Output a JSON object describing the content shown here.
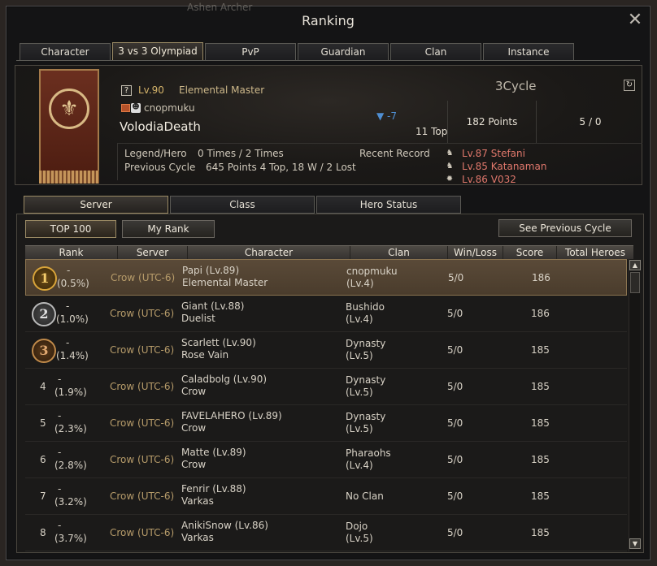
{
  "background_label": "Ashen Archer",
  "window": {
    "title": "Ranking"
  },
  "tabs": [
    {
      "label": "Character"
    },
    {
      "label": "3 vs 3 Olympiad"
    },
    {
      "label": "PvP"
    },
    {
      "label": "Guardian"
    },
    {
      "label": "Clan"
    },
    {
      "label": "Instance"
    }
  ],
  "active_tab": "3 vs 3 Olympiad",
  "profile": {
    "badge": "?",
    "level": "Lv.90",
    "class": "Elemental Master",
    "clan": "cnopmuku",
    "name": "VolodiaDeath",
    "rank_change": "-7",
    "rank": "11 Top",
    "cycle": "3Cycle",
    "points": "182 Points",
    "win_loss": "5 /  0",
    "legend_label": "Legend/Hero",
    "legend_value": "0 Times / 2 Times",
    "prev_label": "Previous Cycle",
    "prev_value": "645 Points 4 Top,  18 W / 2 Lost",
    "recent_label": "Recent Record",
    "recent": [
      {
        "text": "Lv.87 Stefani"
      },
      {
        "text": "Lv.85 Katanaman"
      },
      {
        "text": "Lv.86 V032"
      }
    ]
  },
  "subtabs": [
    {
      "label": "Server"
    },
    {
      "label": "Class"
    },
    {
      "label": "Hero Status"
    }
  ],
  "buttons": {
    "top100": "TOP 100",
    "myrank": "My Rank",
    "prev_cycle": "See Previous Cycle"
  },
  "columns": [
    "Rank",
    "Server",
    "Character",
    "Clan",
    "Win/Loss",
    "Score",
    "Total Heroes"
  ],
  "rows": [
    {
      "rank": "1",
      "medal": "gold",
      "pct1": "-",
      "pct2": "(0.5%)",
      "server": "Crow (UTC-6)",
      "char1": "Papi (Lv.89)",
      "char2": "Elemental Master",
      "clan1": "cnopmuku",
      "clan2": "(Lv.4)",
      "wl": "5/0",
      "score": "186"
    },
    {
      "rank": "2",
      "medal": "silver",
      "pct1": "-",
      "pct2": "(1.0%)",
      "server": "Crow (UTC-6)",
      "char1": "Giant (Lv.88)",
      "char2": "Duelist",
      "clan1": "Bushido",
      "clan2": "(Lv.4)",
      "wl": "5/0",
      "score": "186"
    },
    {
      "rank": "3",
      "medal": "bronze",
      "pct1": "-",
      "pct2": "(1.4%)",
      "server": "Crow (UTC-6)",
      "char1": "Scarlett (Lv.90)",
      "char2": "Rose Vain",
      "clan1": "Dynasty",
      "clan2": "(Lv.5)",
      "wl": "5/0",
      "score": "185"
    },
    {
      "rank": "4",
      "medal": "",
      "pct1": "-",
      "pct2": "(1.9%)",
      "server": "Crow (UTC-6)",
      "char1": "Caladbolg (Lv.90)",
      "char2": "Crow",
      "clan1": "Dynasty",
      "clan2": "(Lv.5)",
      "wl": "5/0",
      "score": "185"
    },
    {
      "rank": "5",
      "medal": "",
      "pct1": "-",
      "pct2": "(2.3%)",
      "server": "Crow (UTC-6)",
      "char1": "FAVELAHERO (Lv.89)",
      "char2": "Crow",
      "clan1": "Dynasty",
      "clan2": "(Lv.5)",
      "wl": "5/0",
      "score": "185"
    },
    {
      "rank": "6",
      "medal": "",
      "pct1": "-",
      "pct2": "(2.8%)",
      "server": "Crow (UTC-6)",
      "char1": "Matte (Lv.89)",
      "char2": "Crow",
      "clan1": "Pharaohs",
      "clan2": "(Lv.4)",
      "wl": "5/0",
      "score": "185"
    },
    {
      "rank": "7",
      "medal": "",
      "pct1": "-",
      "pct2": "(3.2%)",
      "server": "Crow (UTC-6)",
      "char1": "Fenrir (Lv.88)",
      "char2": "Varkas",
      "clan1": "No Clan",
      "clan2": "",
      "wl": "5/0",
      "score": "185"
    },
    {
      "rank": "8",
      "medal": "",
      "pct1": "-",
      "pct2": "(3.7%)",
      "server": "Crow (UTC-6)",
      "char1": "AnikiSnow (Lv.86)",
      "char2": "Varkas",
      "clan1": "Dojo",
      "clan2": "(Lv.5)",
      "wl": "5/0",
      "score": "185"
    }
  ]
}
